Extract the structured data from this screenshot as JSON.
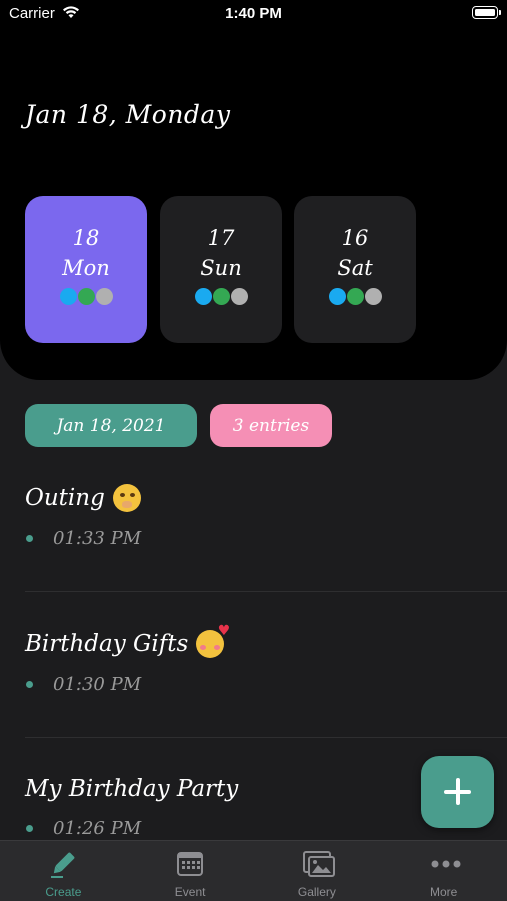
{
  "status_bar": {
    "carrier": "Carrier",
    "time": "1:40 PM"
  },
  "header": {
    "date_title": "Jan 18, Monday",
    "days": [
      {
        "num": "18",
        "name": "Mon",
        "active": true
      },
      {
        "num": "17",
        "name": "Sun",
        "active": false
      },
      {
        "num": "16",
        "name": "Sat",
        "active": false
      }
    ],
    "dot_colors": [
      "#1aaaf0",
      "#34a853",
      "#b0b0b0"
    ],
    "accent_color": "#7b68ee"
  },
  "pills": {
    "date": "Jan 18, 2021",
    "count": "3 entries"
  },
  "entries": [
    {
      "title": "Outing",
      "time": "01:33 PM",
      "emoji": "shushing-face-emoji"
    },
    {
      "title": "Birthday Gifts",
      "time": "01:30 PM",
      "emoji": "smiling-face-with-hearts-emoji"
    },
    {
      "title": "My Birthday Party",
      "time": "01:26 PM",
      "emoji": ""
    }
  ],
  "fab": {
    "icon": "plus-icon",
    "color": "#4a9d8d"
  },
  "tabbar": {
    "items": [
      {
        "label": "Create",
        "icon": "pencil-icon",
        "active": true
      },
      {
        "label": "Event",
        "icon": "calendar-icon",
        "active": false
      },
      {
        "label": "Gallery",
        "icon": "gallery-icon",
        "active": false
      },
      {
        "label": "More",
        "icon": "more-icon",
        "active": false
      }
    ]
  }
}
